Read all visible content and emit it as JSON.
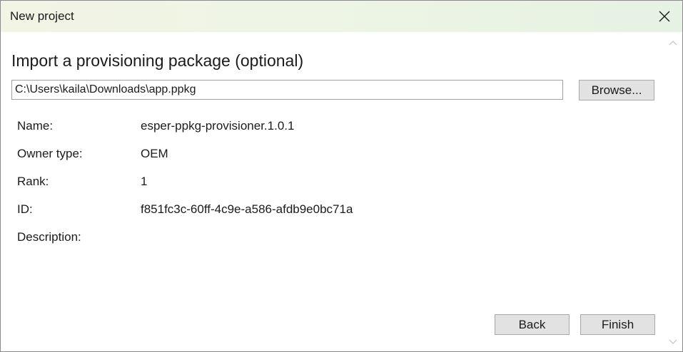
{
  "window": {
    "title": "New project"
  },
  "main": {
    "heading": "Import a provisioning package (optional)",
    "path_input": {
      "value": "C:\\Users\\kaila\\Downloads\\app.ppkg",
      "placeholder": ""
    },
    "browse_label": "Browse...",
    "details": [
      {
        "label": "Name:",
        "value": "esper-ppkg-provisioner.1.0.1"
      },
      {
        "label": "Owner type:",
        "value": "OEM"
      },
      {
        "label": "Rank:",
        "value": "1"
      },
      {
        "label": "ID:",
        "value": "f851fc3c-60ff-4c9e-a586-afdb9e0bc71a"
      },
      {
        "label": "Description:",
        "value": ""
      }
    ]
  },
  "footer": {
    "back_label": "Back",
    "finish_label": "Finish"
  },
  "icons": {
    "close": "close-icon",
    "scroll_up": "chevron-up-icon",
    "scroll_down": "chevron-down-icon"
  }
}
